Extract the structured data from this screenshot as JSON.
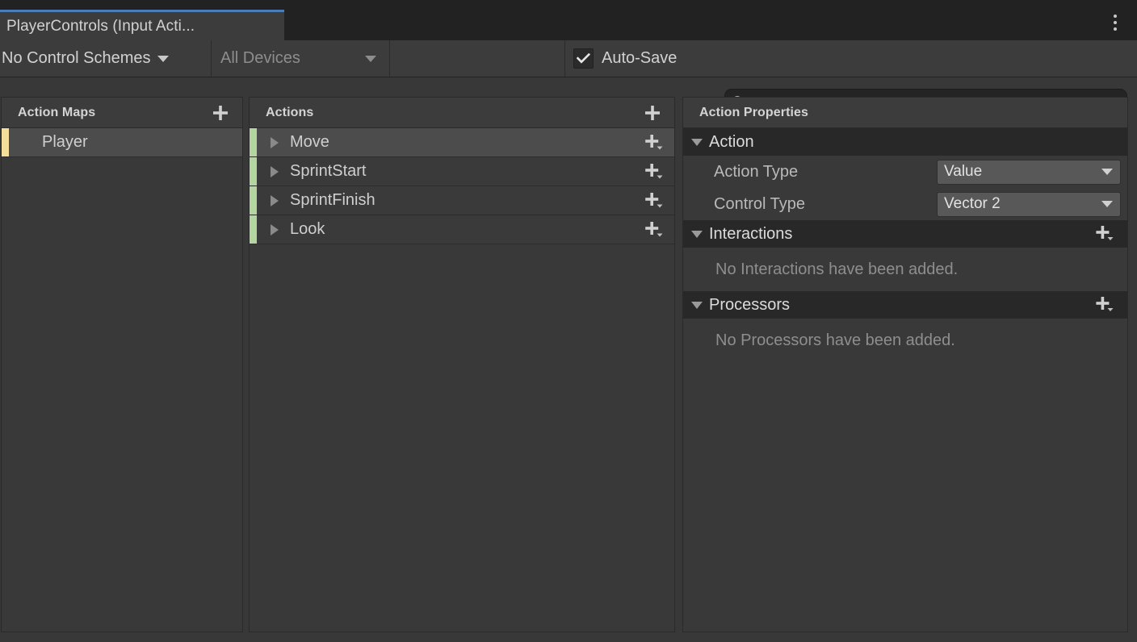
{
  "window": {
    "tab_label": "PlayerControls (Input Acti...",
    "menu_icon": "kebab-menu-icon"
  },
  "toolbar": {
    "control_schemes_label": "No Control Schemes",
    "devices_label": "All Devices",
    "auto_save_label": "Auto-Save",
    "auto_save_checked": true,
    "search_value": "",
    "search_placeholder": "",
    "search_icon": "search-icon",
    "add_icon": "plus-icon"
  },
  "action_maps": {
    "title": "Action Maps",
    "add_label": "+",
    "accent_color": "#f5dd9b",
    "items": [
      {
        "label": "Player",
        "selected": true
      }
    ]
  },
  "actions": {
    "title": "Actions",
    "add_label": "+",
    "accent_color": "#b3d6a0",
    "items": [
      {
        "label": "Move",
        "selected": true,
        "expanded": false
      },
      {
        "label": "SprintStart",
        "selected": false,
        "expanded": false
      },
      {
        "label": "SprintFinish",
        "selected": false,
        "expanded": false
      },
      {
        "label": "Look",
        "selected": false,
        "expanded": false
      }
    ]
  },
  "properties": {
    "title": "Action Properties",
    "sections": [
      {
        "label": "Action",
        "expanded": true,
        "fields": [
          {
            "label": "Action Type",
            "value": "Value"
          },
          {
            "label": "Control Type",
            "value": "Vector 2"
          }
        ]
      },
      {
        "label": "Interactions",
        "expanded": true,
        "empty_text": "No Interactions have been added."
      },
      {
        "label": "Processors",
        "expanded": true,
        "empty_text": "No Processors have been added."
      }
    ]
  },
  "colors": {
    "tab_active_border": "#4a7db5",
    "panel_bg": "#393939",
    "selection_bg": "#4c4c4c",
    "section_header_bg": "#282828"
  }
}
